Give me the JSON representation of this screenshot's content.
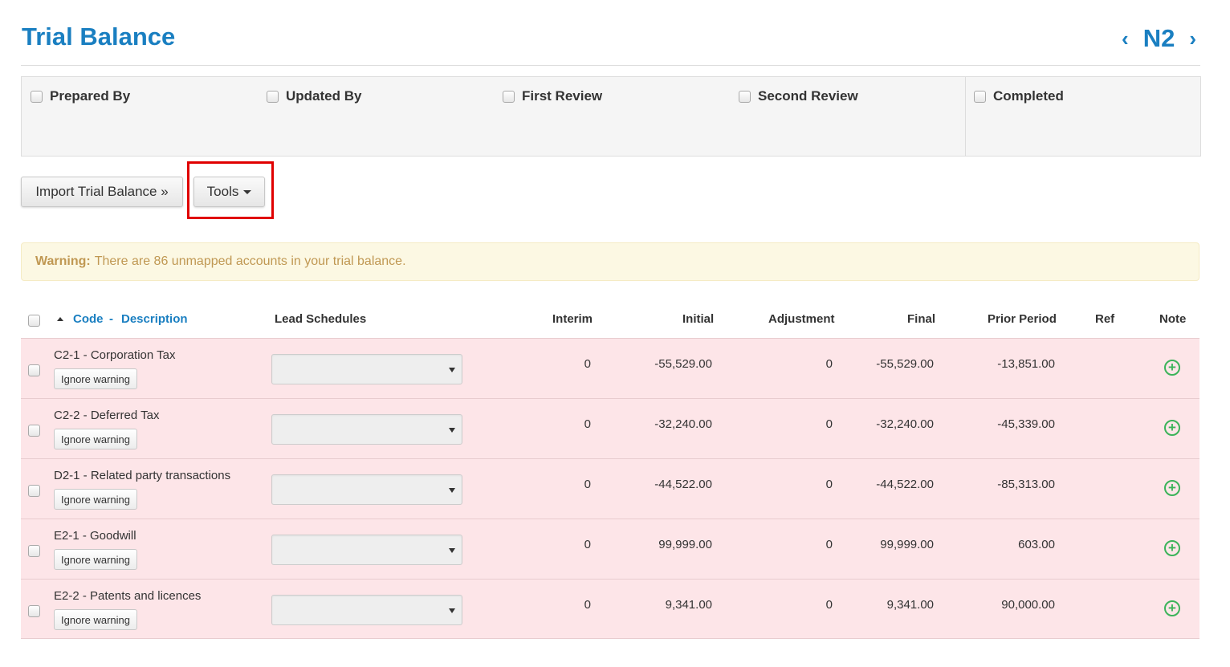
{
  "header": {
    "title": "Trial Balance",
    "nav_label": "N2",
    "prev_icon": "chevron-left-icon",
    "next_icon": "chevron-right-icon",
    "prev_glyph": "‹",
    "next_glyph": "›"
  },
  "signoff": {
    "items": [
      {
        "label": "Prepared By"
      },
      {
        "label": "Updated By"
      },
      {
        "label": "First Review"
      },
      {
        "label": "Second Review"
      },
      {
        "label": "Completed"
      }
    ]
  },
  "toolbar": {
    "import_label": "Import Trial Balance »",
    "tools_label": "Tools"
  },
  "warning": {
    "prefix": "Warning:",
    "message": "There are 86 unmapped accounts in your trial balance."
  },
  "table": {
    "columns": {
      "code": "Code",
      "separator": "-",
      "description": "Description",
      "lead_schedules": "Lead Schedules",
      "interim": "Interim",
      "initial": "Initial",
      "adjustment": "Adjustment",
      "final": "Final",
      "prior_period": "Prior Period",
      "ref": "Ref",
      "note": "Note"
    },
    "ignore_label": "Ignore warning",
    "rows": [
      {
        "account": "C2-1 - Corporation Tax",
        "interim": "0",
        "initial": "-55,529.00",
        "adjustment": "0",
        "final": "-55,529.00",
        "prior": "-13,851.00"
      },
      {
        "account": "C2-2 - Deferred Tax",
        "interim": "0",
        "initial": "-32,240.00",
        "adjustment": "0",
        "final": "-32,240.00",
        "prior": "-45,339.00"
      },
      {
        "account": "D2-1 - Related party transactions",
        "interim": "0",
        "initial": "-44,522.00",
        "adjustment": "0",
        "final": "-44,522.00",
        "prior": "-85,313.00"
      },
      {
        "account": "E2-1 - Goodwill",
        "interim": "0",
        "initial": "99,999.00",
        "adjustment": "0",
        "final": "99,999.00",
        "prior": "603.00"
      },
      {
        "account": "E2-2 - Patents and licences",
        "interim": "0",
        "initial": "9,341.00",
        "adjustment": "0",
        "final": "9,341.00",
        "prior": "90,000.00"
      }
    ]
  },
  "colors": {
    "accent": "#1a7fc1",
    "row_warning_bg": "#fde5e8",
    "warning_text": "#c09853",
    "highlight": "#e00000",
    "add_note": "#3cb35a"
  }
}
